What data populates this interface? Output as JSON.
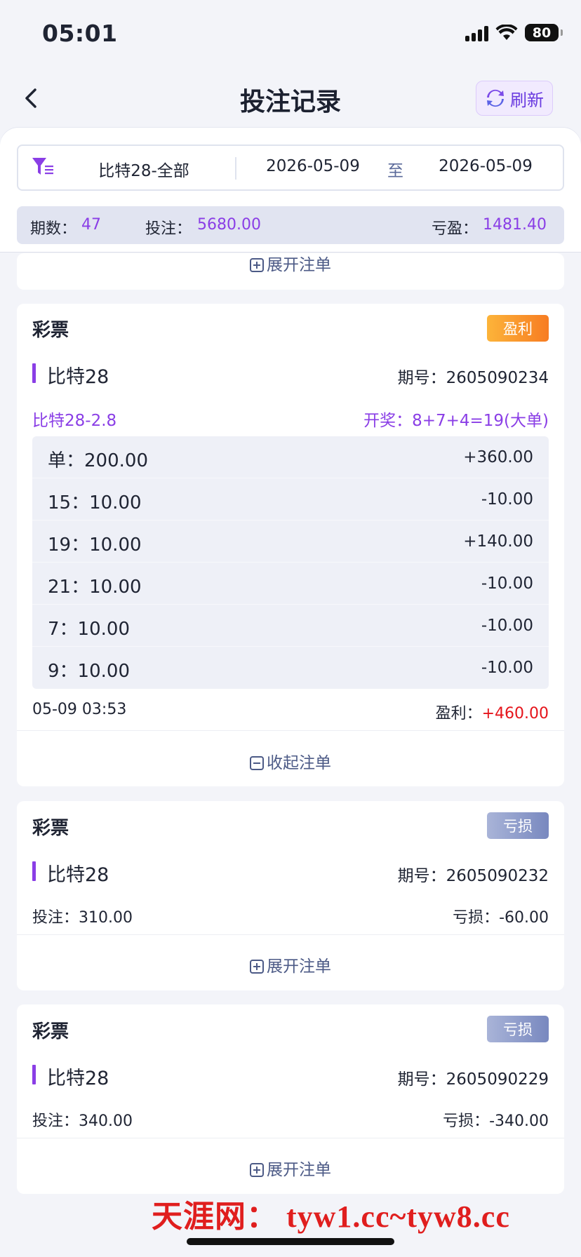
{
  "status_bar": {
    "time": "05:01",
    "battery": "80"
  },
  "header": {
    "title": "投注记录",
    "refresh_label": "刷新"
  },
  "filter": {
    "lottery": "比特28-全部",
    "date_start": "2026-05-09",
    "separator": "至",
    "date_end": "2026-05-09"
  },
  "summary": {
    "periods_label": "期数：",
    "periods_value": "47",
    "bet_label": "投注：",
    "bet_value": "5680.00",
    "pl_label": "亏盈：",
    "pl_value": "1481.40"
  },
  "top_partial": {
    "expand_label": "展开注单"
  },
  "cards": [
    {
      "type": "彩票",
      "badge": "盈利",
      "game": "比特28",
      "issue_label": "期号：",
      "issue": "2605090234",
      "play": "比特28-2.8",
      "draw": "开奖：8+7+4=19(大单)",
      "bets": [
        {
          "label": "单：",
          "amount": "200.00",
          "result": "+360.00"
        },
        {
          "label": "15：",
          "amount": "10.00",
          "result": "-10.00"
        },
        {
          "label": "19：",
          "amount": "10.00",
          "result": "+140.00"
        },
        {
          "label": "21：",
          "amount": "10.00",
          "result": "-10.00"
        },
        {
          "label": "7：",
          "amount": "10.00",
          "result": "-10.00"
        },
        {
          "label": "9：",
          "amount": "10.00",
          "result": "-10.00"
        }
      ],
      "time": "05-09 03:53",
      "profit_label": "盈利：",
      "profit": "+460.00",
      "collapse_label": "收起注单"
    },
    {
      "type": "彩票",
      "badge": "亏损",
      "game": "比特28",
      "issue_label": "期号：",
      "issue": "2605090232",
      "bet_label": "投注：",
      "bet": "310.00",
      "loss_label": "亏损：",
      "loss": "-60.00",
      "expand_label": "展开注单"
    },
    {
      "type": "彩票",
      "badge": "亏损",
      "game": "比特28",
      "issue_label": "期号：",
      "issue": "2605090229",
      "bet_label": "投注：",
      "bet": "340.00",
      "loss_label": "亏损：",
      "loss": "-340.00",
      "expand_label": "展开注单"
    }
  ],
  "watermark": "天涯网：  tyw1.cc~tyw8.cc",
  "colors": {
    "accent": "#8a3ee6",
    "win": "#e5141b",
    "badge_win": "#f7941d",
    "badge_loss": "#8e9acb"
  }
}
